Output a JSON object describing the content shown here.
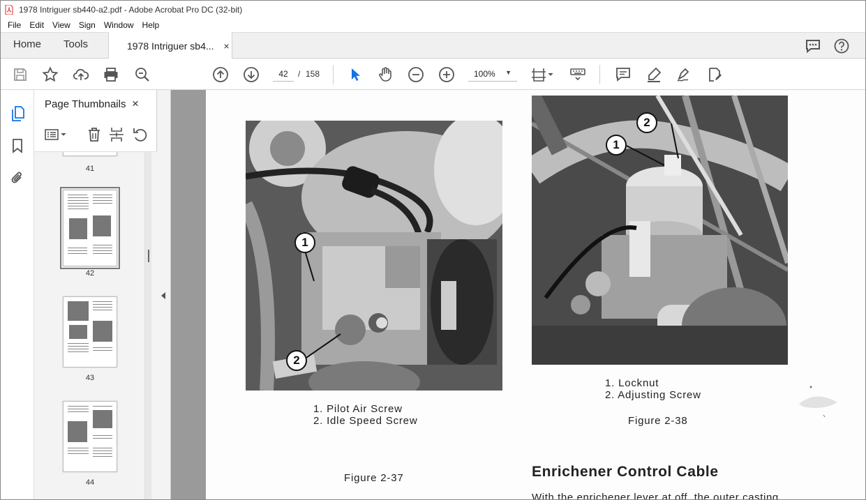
{
  "window": {
    "title": "1978 Intriguer sb440-a2.pdf - Adobe Acrobat Pro DC (32-bit)"
  },
  "menu": [
    "File",
    "Edit",
    "View",
    "Sign",
    "Window",
    "Help"
  ],
  "tabs": {
    "home": "Home",
    "tools": "Tools",
    "document": "1978 Intriguer sb4...",
    "close": "×"
  },
  "toolbar": {
    "page_current": "42",
    "page_separator": "/",
    "page_total": "158",
    "zoom": "100%"
  },
  "panel": {
    "title": "Page Thumbnails",
    "close": "×"
  },
  "thumbnails": [
    {
      "label": "41"
    },
    {
      "label": "42",
      "selected": true
    },
    {
      "label": "43"
    },
    {
      "label": "44"
    }
  ],
  "document": {
    "figure_37": {
      "callouts": [
        "1",
        "2"
      ],
      "captions": [
        "1.  Pilot Air Screw",
        "2.  Idle Speed Screw"
      ],
      "title": "Figure 2-37"
    },
    "figure_38": {
      "callouts": [
        "1",
        "2"
      ],
      "captions": [
        "1.  Locknut",
        "2.  Adjusting Screw"
      ],
      "title": "Figure 2-38"
    },
    "section_heading": "Enrichener Control Cable",
    "body_start": "With the enrichener lever at off, the outer casting"
  },
  "colors": {
    "accent": "#1473e6",
    "pdf_red": "#d7261e",
    "viewer_bg": "#9a9a9a"
  }
}
